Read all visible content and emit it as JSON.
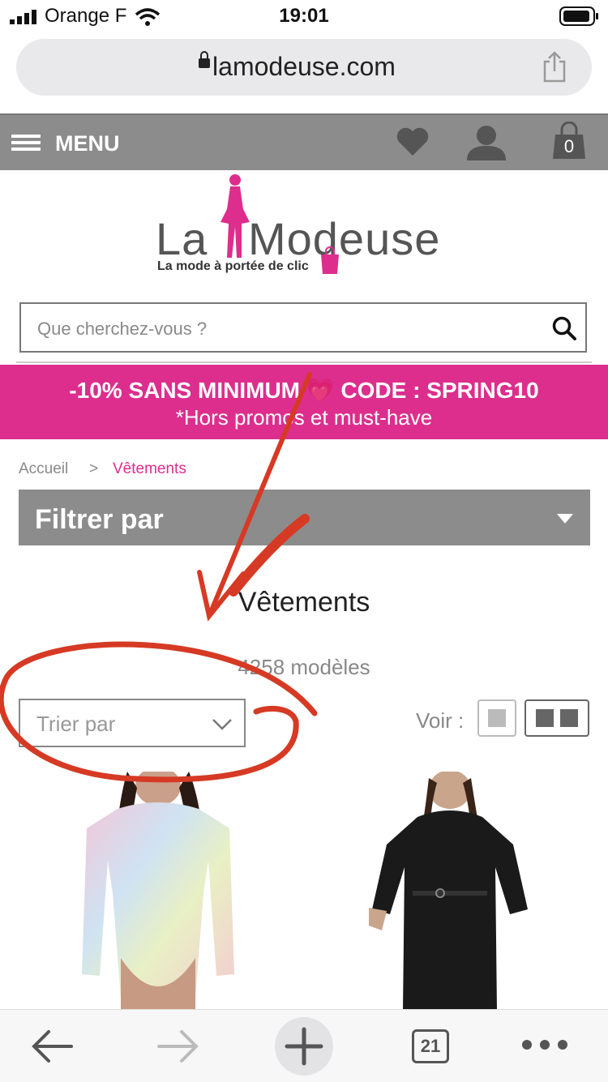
{
  "status_bar": {
    "carrier": "Orange F",
    "time": "19:01"
  },
  "browser": {
    "url": "lamodeuse.com",
    "tab_count": "21"
  },
  "site_header": {
    "menu_label": "MENU",
    "cart_count": "0"
  },
  "logo": {
    "name_part1": "La",
    "name_part2": "Modeuse",
    "tagline": "La mode à portée de clic"
  },
  "search": {
    "placeholder": "Que cherchez-vous ?"
  },
  "promo": {
    "line1": "-10% SANS MINIMUM 💗 CODE : SPRING10",
    "line2": "*Hors promos et must-have"
  },
  "breadcrumb": {
    "home": "Accueil",
    "separator": ">",
    "current": "Vêtements"
  },
  "filter": {
    "label": "Filtrer par"
  },
  "listing": {
    "title": "Vêtements",
    "count": "4258 modèles"
  },
  "sort": {
    "placeholder": "Trier par"
  },
  "view": {
    "label": "Voir :"
  },
  "colors": {
    "brand_pink": "#dd2e8d",
    "header_gray": "#8c8c8c",
    "annotation_red": "#d63a24"
  },
  "icons": [
    "signal-icon",
    "wifi-icon",
    "battery-icon",
    "lock-icon",
    "share-icon",
    "hamburger-icon",
    "heart-icon",
    "user-icon",
    "bag-icon",
    "search-icon",
    "chevron-down-icon",
    "grid-1-icon",
    "grid-2-icon",
    "back-icon",
    "forward-icon",
    "plus-icon",
    "tabs-icon",
    "more-icon"
  ]
}
